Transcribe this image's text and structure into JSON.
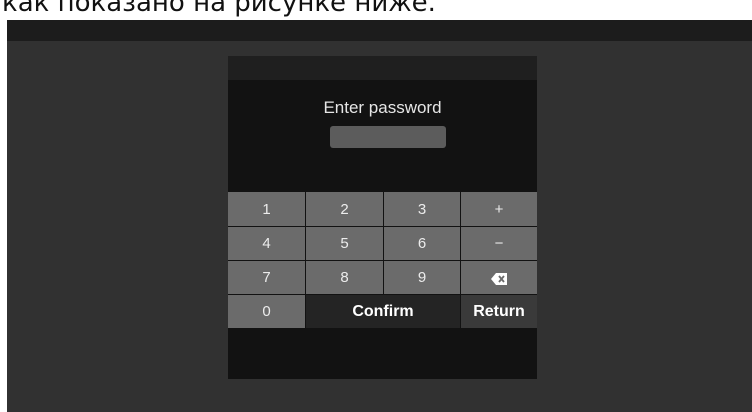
{
  "caption": "как показано на рисунке ниже.",
  "dialog": {
    "prompt": "Enter password",
    "password_value": ""
  },
  "keypad": {
    "rows": [
      [
        "1",
        "2",
        "3",
        "+"
      ],
      [
        "4",
        "5",
        "6",
        "−"
      ],
      [
        "7",
        "8",
        "9",
        "backspace-icon"
      ]
    ],
    "zero": "0",
    "confirm": "Confirm",
    "return": "Return"
  },
  "colors": {
    "screen_bg": "#313131",
    "dialog_bg": "#121212",
    "key_bg": "#6b6b6b",
    "confirm_bg": "#242424"
  }
}
